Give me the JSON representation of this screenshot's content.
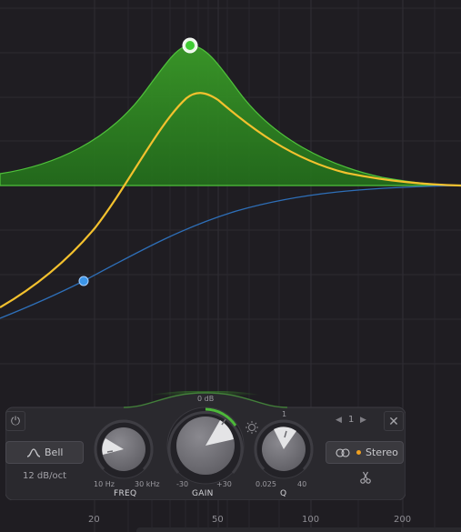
{
  "axis": {
    "freq_labels": [
      "20",
      "50",
      "100",
      "200"
    ]
  },
  "band": {
    "shape_label": "Bell",
    "slope_label": "12 dB/oct",
    "band_number": "1",
    "stereo_label": "Stereo",
    "freq": {
      "name": "FREQ",
      "min": "10 Hz",
      "max": "30 kHz"
    },
    "gain": {
      "name": "GAIN",
      "top": "0 dB",
      "min": "-30",
      "max": "+30"
    },
    "q": {
      "name": "Q",
      "top": "1",
      "min": "0.025",
      "max": "40"
    }
  },
  "colors": {
    "background": "#1f1d22",
    "band_fill": "#2f8a23",
    "band_node": "#3fcb32",
    "sum_curve": "#f3c12e",
    "secondary_curve": "#2e6fb8",
    "secondary_node": "#3c95e8",
    "stereo_dot": "#f0a020"
  },
  "icons": {
    "power": "power-icon",
    "shape": "bell-shape-icon",
    "close": "close-icon",
    "stereo": "stereo-link-icon",
    "scissors": "scissors-icon",
    "prev": "chevron-left-icon",
    "next": "chevron-right-icon",
    "dynamics": "sun-icon"
  }
}
